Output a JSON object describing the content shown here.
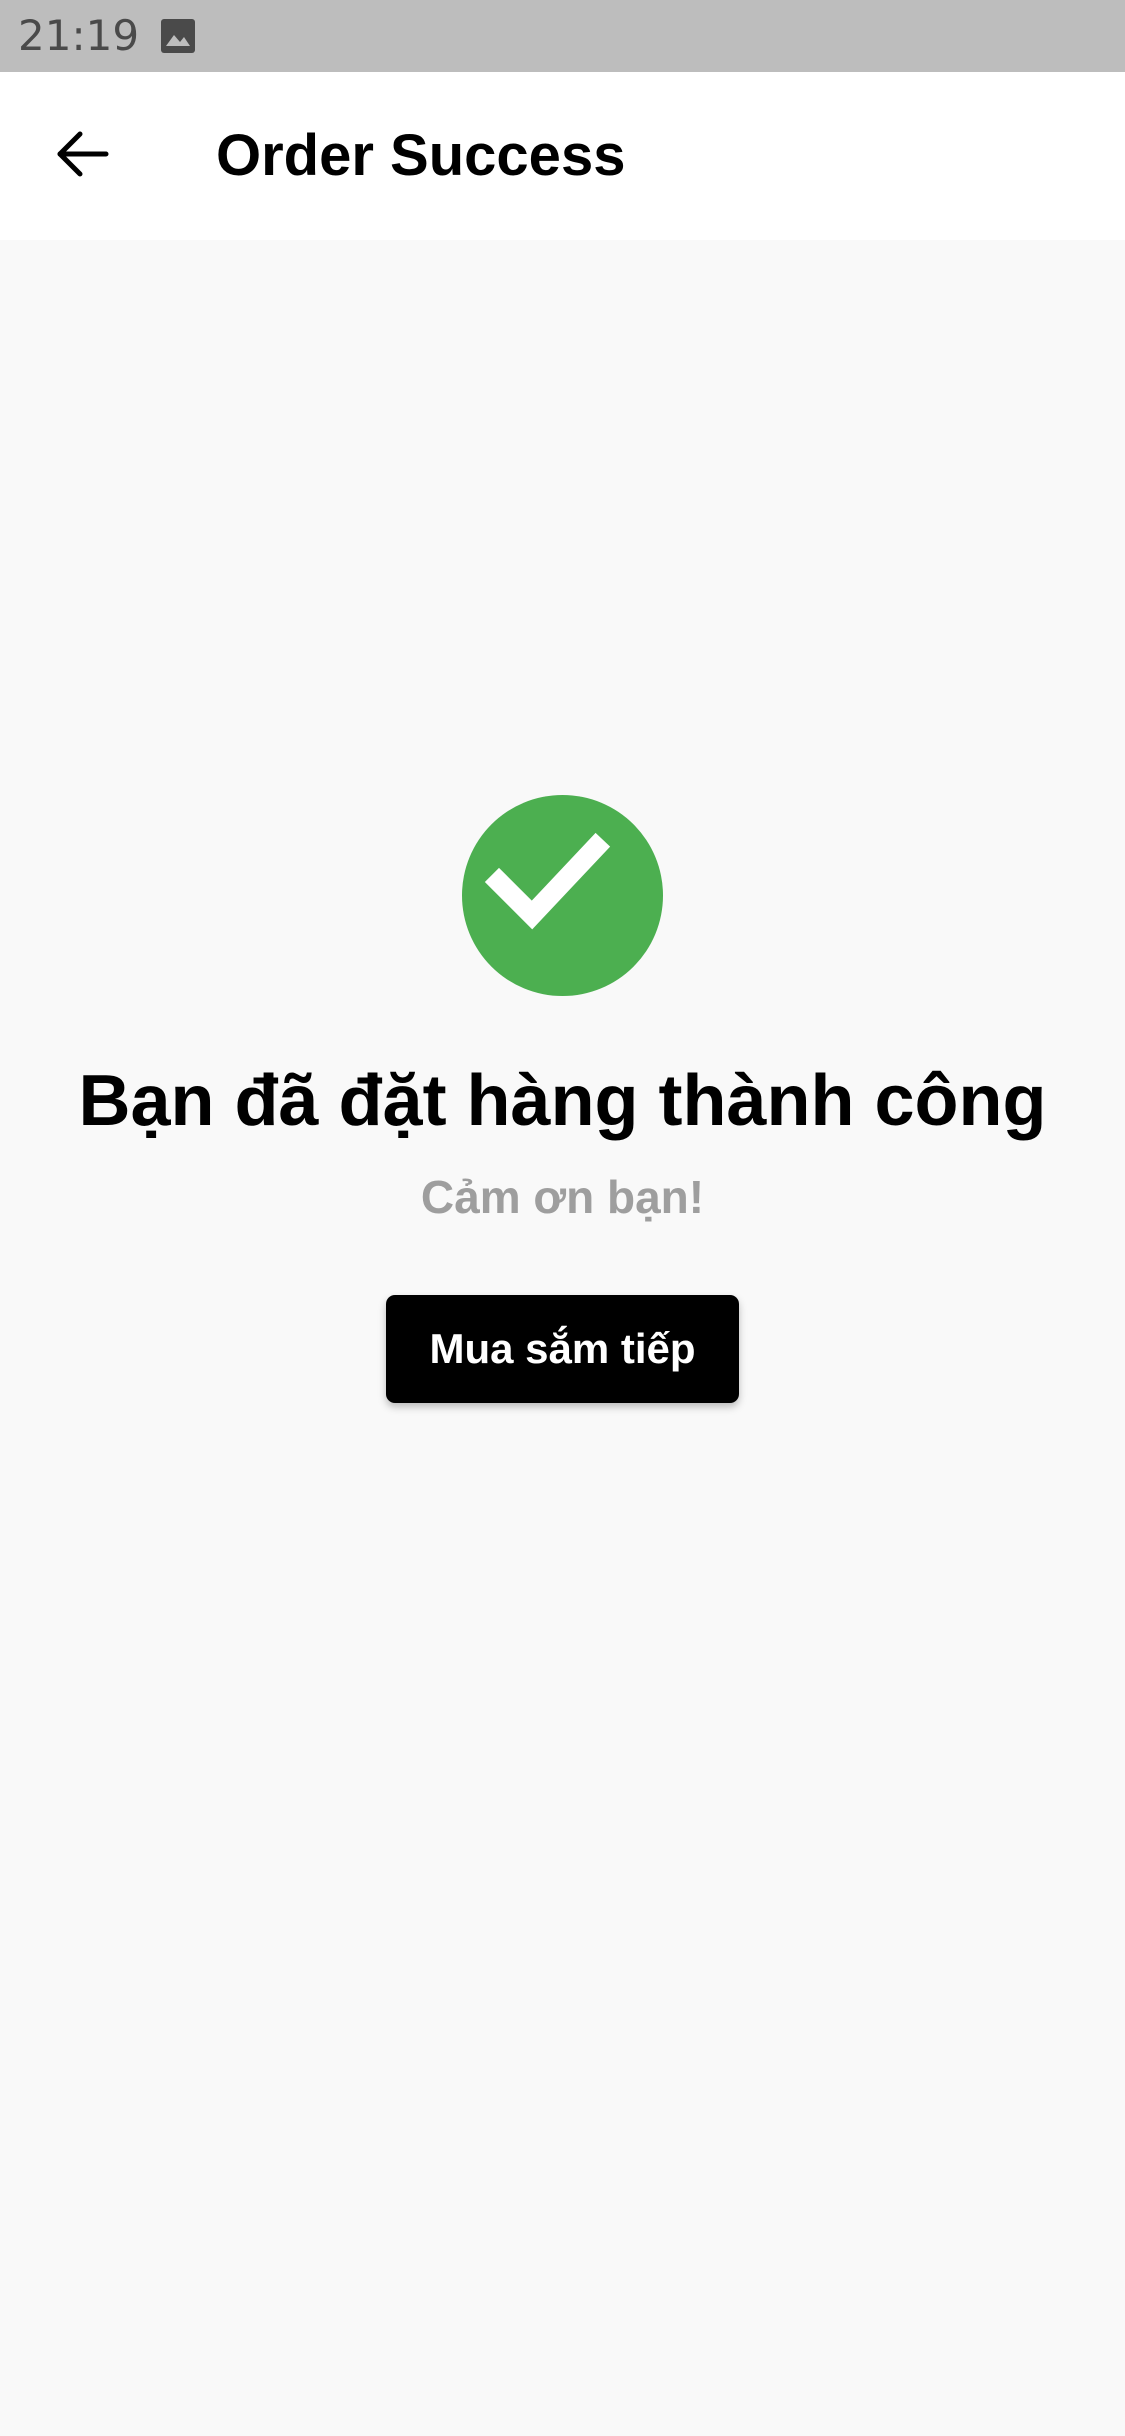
{
  "status_bar": {
    "time": "21:19",
    "notification_icon": "image-icon"
  },
  "app_bar": {
    "back_icon": "arrow-back-icon",
    "title": "Order Success"
  },
  "main": {
    "success_icon": "check-circle-icon",
    "success_color": "#4caf50",
    "headline": "Bạn đã đặt hàng thành công",
    "subline": "Cảm ơn bạn!",
    "continue_button_label": "Mua sắm tiếp"
  }
}
